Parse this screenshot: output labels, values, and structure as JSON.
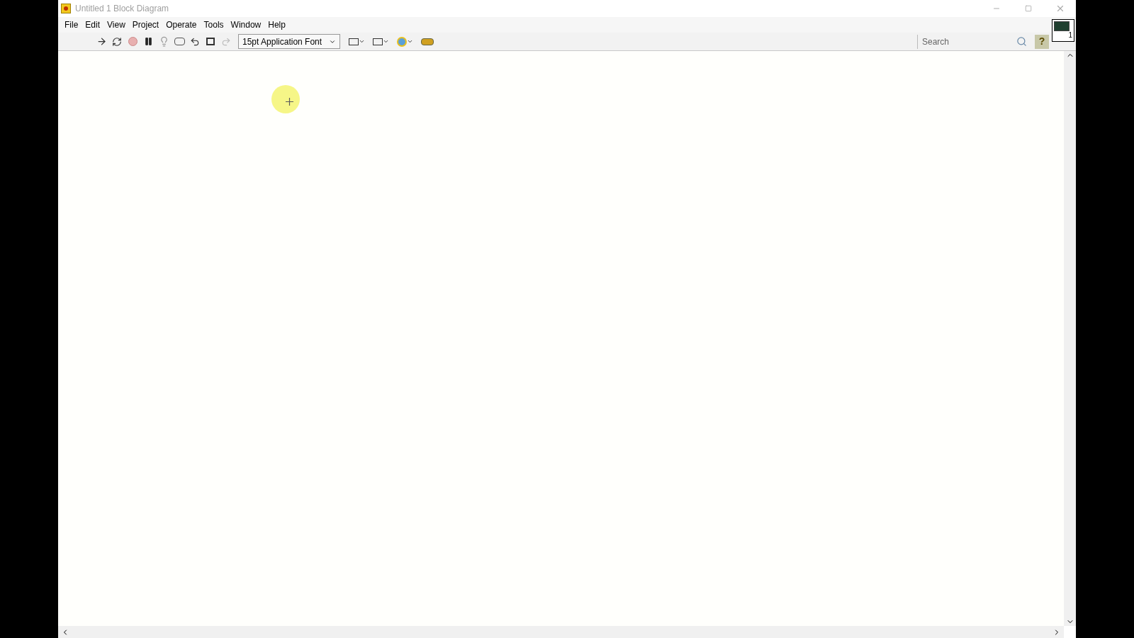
{
  "window": {
    "title": "Untitled 1 Block Diagram"
  },
  "menu": [
    "File",
    "Edit",
    "View",
    "Project",
    "Operate",
    "Tools",
    "Window",
    "Help"
  ],
  "toolbar": {
    "font": "15pt Application Font",
    "search": {
      "placeholder": "Search"
    },
    "vi_icon_label": "1",
    "help": "?"
  }
}
